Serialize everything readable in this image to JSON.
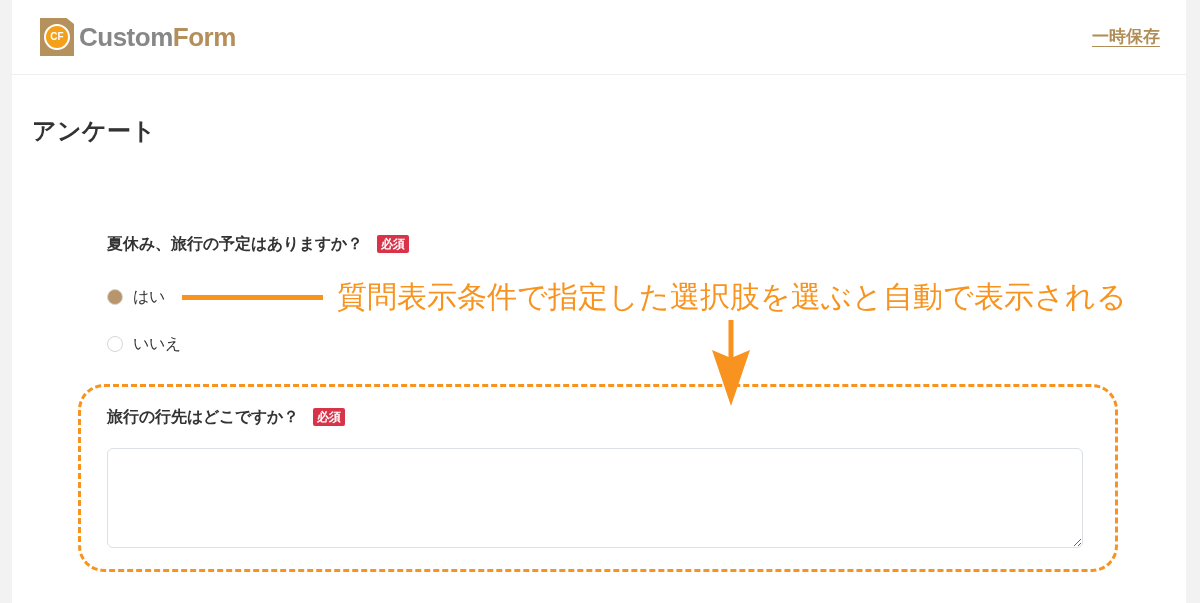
{
  "header": {
    "logo": {
      "mark": "CF",
      "parts": [
        {
          "text": "Custom",
          "color": "#878787"
        },
        {
          "text": "Form",
          "color": "#b38f5c"
        }
      ]
    },
    "save_link": "一時保存"
  },
  "title": "アンケート",
  "questions": [
    {
      "kind": "radio",
      "label": "夏休み、旅行の予定はありますか？",
      "badge": "必須",
      "options": [
        {
          "label": "はい",
          "selected": true
        },
        {
          "label": "いいえ",
          "selected": false
        }
      ]
    },
    {
      "kind": "textarea",
      "label": "旅行の行先はどこですか？",
      "badge": "必須",
      "highlighted": true
    }
  ],
  "annotation": {
    "text": "質問表示条件で指定した選択肢を選ぶと自動で表示される"
  }
}
